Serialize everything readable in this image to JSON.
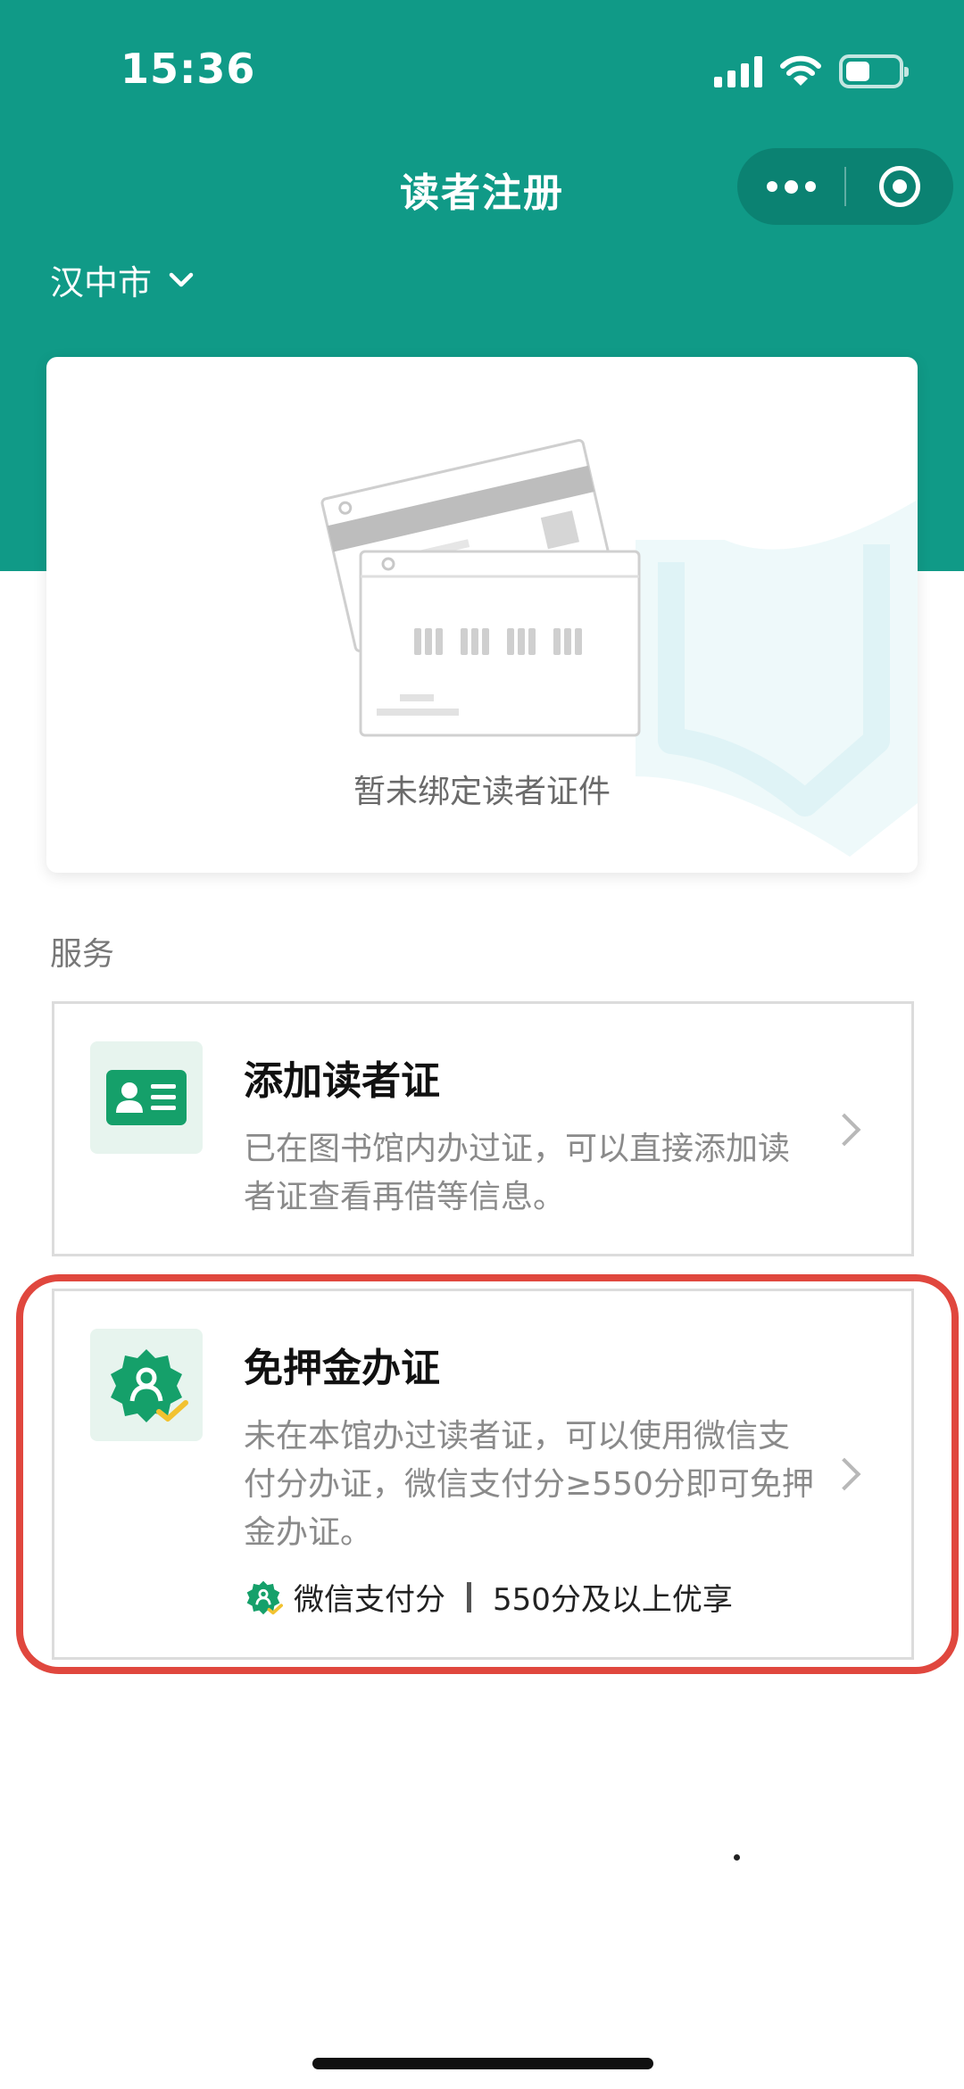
{
  "status_bar": {
    "time": "15:36",
    "icons": [
      "signal-icon",
      "wifi-icon",
      "battery-icon"
    ]
  },
  "header": {
    "title": "读者注册",
    "capsule_icons": [
      "more-dots-icon",
      "close-target-icon"
    ],
    "city": "汉中市",
    "city_icon": "chevron-down-icon"
  },
  "card": {
    "empty_text": "暂未绑定读者证件",
    "illustration_icon": "library-card-illustration"
  },
  "services": {
    "section_label": "服务",
    "add_card": {
      "title": "添加读者证",
      "description": "已在图书馆内办过证，可以直接添加读者证查看再借等信息。",
      "icon": "id-card-icon"
    },
    "deposit_free": {
      "title": "免押金办证",
      "description": "未在本馆办过读者证，可以使用微信支付分办证，微信支付分≥550分即可免押金办证。",
      "icon": "score-badge-icon",
      "badge_label": "微信支付分",
      "badge_note": "550分及以上优享"
    }
  },
  "colors": {
    "brand": "#109a87",
    "icon_green": "#15a06a",
    "highlight": "#e0473e"
  }
}
